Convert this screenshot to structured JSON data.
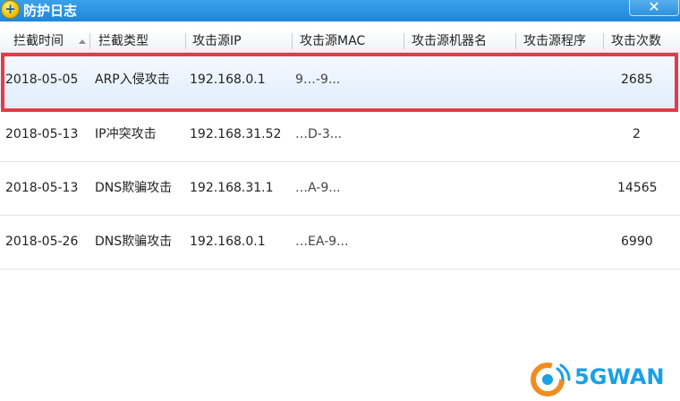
{
  "window": {
    "title": "防护日志",
    "icon": "plus-shield-icon",
    "close_label": "✕"
  },
  "table": {
    "columns": [
      "拦截时间",
      "拦截类型",
      "攻击源IP",
      "攻击源MAC",
      "攻击源机器名",
      "攻击源程序",
      "攻击次数"
    ],
    "sorted_column": "拦截时间",
    "sort_direction": "ascending",
    "rows": [
      {
        "time": "2018-05-05",
        "type": "ARP入侵攻击",
        "ip": "192.168.0.1",
        "mac": "9…-9...",
        "host": "",
        "program": "",
        "count": "2685",
        "selected": true
      },
      {
        "time": "2018-05-13",
        "type": "IP冲突攻击",
        "ip": "192.168.31.52",
        "mac": "…D-3...",
        "host": "",
        "program": "",
        "count": "2",
        "selected": false
      },
      {
        "time": "2018-05-13",
        "type": "DNS欺骗攻击",
        "ip": "192.168.31.1",
        "mac": "…A-9...",
        "host": "",
        "program": "",
        "count": "14565",
        "selected": false
      },
      {
        "time": "2018-05-26",
        "type": "DNS欺骗攻击",
        "ip": "192.168.0.1",
        "mac": "…EA-9...",
        "host": "",
        "program": "",
        "count": "6990",
        "selected": false
      }
    ]
  },
  "annotation": {
    "highlight_color": "#e53a44"
  },
  "watermark": {
    "text": "5GWAN",
    "color": "#1aa0e6",
    "accent": "#f28c1e"
  }
}
